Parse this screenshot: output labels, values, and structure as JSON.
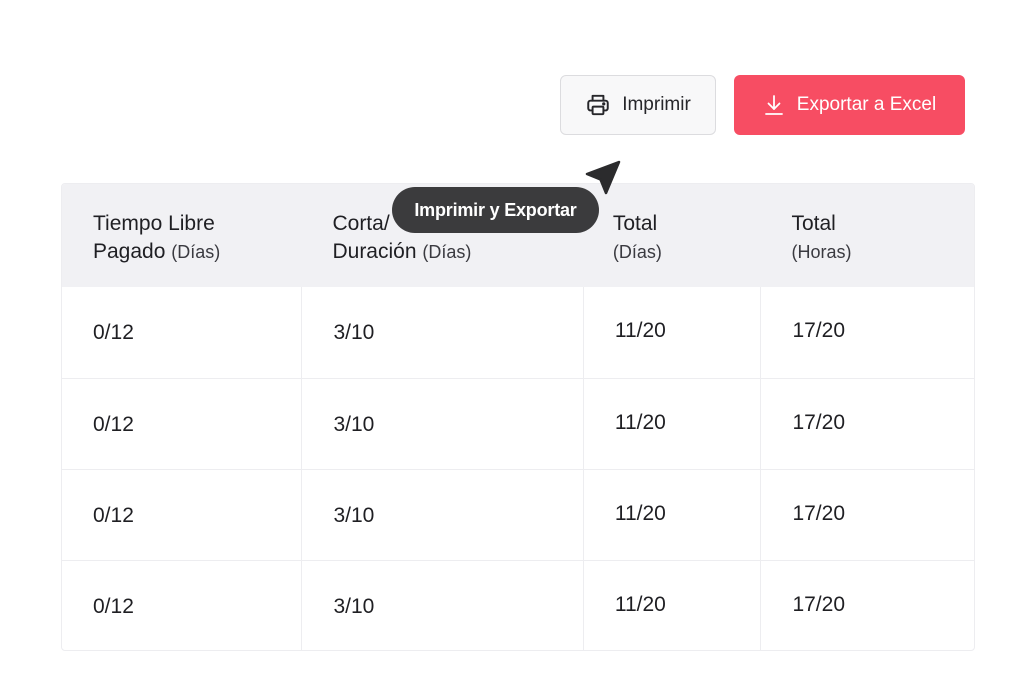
{
  "toolbar": {
    "print_label": "Imprimir",
    "print_icon": "printer-icon",
    "export_label": "Exportar a Excel",
    "export_icon": "download-icon",
    "export_color": "#f74d63"
  },
  "tooltip": {
    "text": "Imprimir y Exportar"
  },
  "table": {
    "headers": [
      {
        "line1": "Tiempo Libre",
        "line2": "Pagado",
        "unit": "(Días)"
      },
      {
        "line1": "Corta/",
        "line2": "Duración",
        "unit": "(Días)"
      },
      {
        "line1": "Total",
        "line2": "",
        "unit": "(Días)"
      },
      {
        "line1": "Total",
        "line2": "",
        "unit": "(Horas)"
      }
    ],
    "rows": [
      [
        "0/12",
        "3/10",
        "11/20",
        "17/20"
      ],
      [
        "0/12",
        "3/10",
        "11/20",
        "17/20"
      ],
      [
        "0/12",
        "3/10",
        "11/20",
        "17/20"
      ],
      [
        "0/12",
        "3/10",
        "11/20",
        "17/20"
      ]
    ]
  }
}
